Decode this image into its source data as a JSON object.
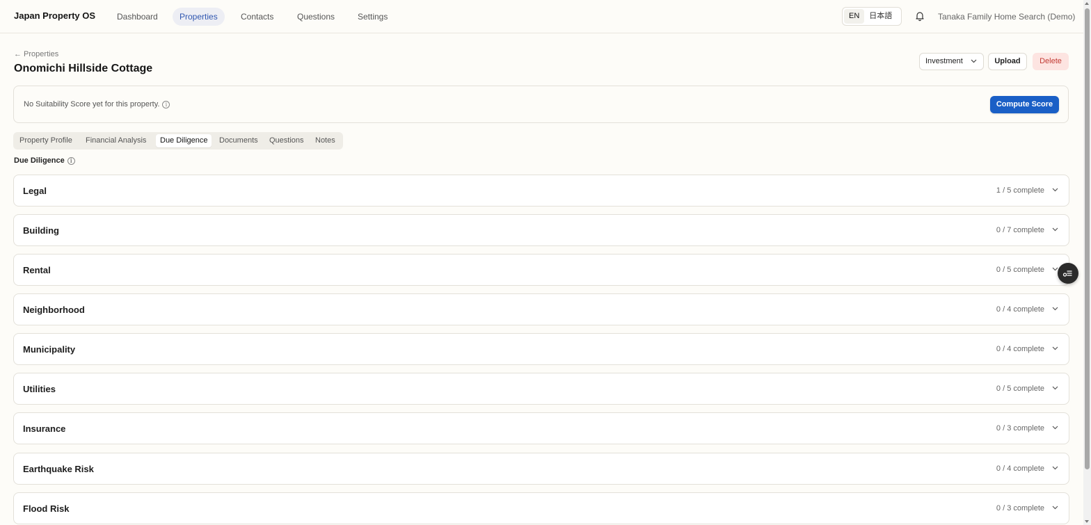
{
  "app": {
    "title": "Japan Property OS"
  },
  "nav": {
    "items": [
      {
        "label": "Dashboard"
      },
      {
        "label": "Properties"
      },
      {
        "label": "Contacts"
      },
      {
        "label": "Questions"
      },
      {
        "label": "Settings"
      }
    ],
    "active": "Properties"
  },
  "language": {
    "options": [
      "EN",
      "日本語"
    ],
    "selected": "EN"
  },
  "user": {
    "name": "Tanaka Family Home Search (Demo)"
  },
  "header": {
    "back_label": "← Properties",
    "title": "Onomichi Hillside Cottage",
    "category_select": "Investment",
    "upload_label": "Upload",
    "delete_label": "Delete"
  },
  "score": {
    "message": "No Suitability Score yet for this property.",
    "compute_label": "Compute Score"
  },
  "tabs": {
    "items": [
      {
        "label": "Property Profile"
      },
      {
        "label": "Financial Analysis"
      },
      {
        "label": "Due Diligence"
      },
      {
        "label": "Documents"
      },
      {
        "label": "Questions"
      },
      {
        "label": "Notes"
      }
    ],
    "active": "Due Diligence"
  },
  "due_diligence": {
    "title": "Due Diligence",
    "sections": [
      {
        "label": "Legal",
        "status": "1 / 5 complete"
      },
      {
        "label": "Building",
        "status": "0 / 7 complete"
      },
      {
        "label": "Rental",
        "status": "0 / 5 complete"
      },
      {
        "label": "Neighborhood",
        "status": "0 / 4 complete"
      },
      {
        "label": "Municipality",
        "status": "0 / 4 complete"
      },
      {
        "label": "Utilities",
        "status": "0 / 5 complete"
      },
      {
        "label": "Insurance",
        "status": "0 / 3 complete"
      },
      {
        "label": "Earthquake Risk",
        "status": "0 / 4 complete"
      },
      {
        "label": "Flood Risk",
        "status": "0 / 3 complete"
      }
    ]
  },
  "colors": {
    "accent": "#1a5fc6",
    "nav_active_text": "#2f56b0",
    "delete_bg": "#fde4e1",
    "delete_text": "#c23a33",
    "fab_bg": "#2b2b2b"
  },
  "icons": {
    "bell": "bell-icon",
    "info": "info-icon",
    "chevron": "chevron-down-icon",
    "fab": "checklist-icon"
  }
}
